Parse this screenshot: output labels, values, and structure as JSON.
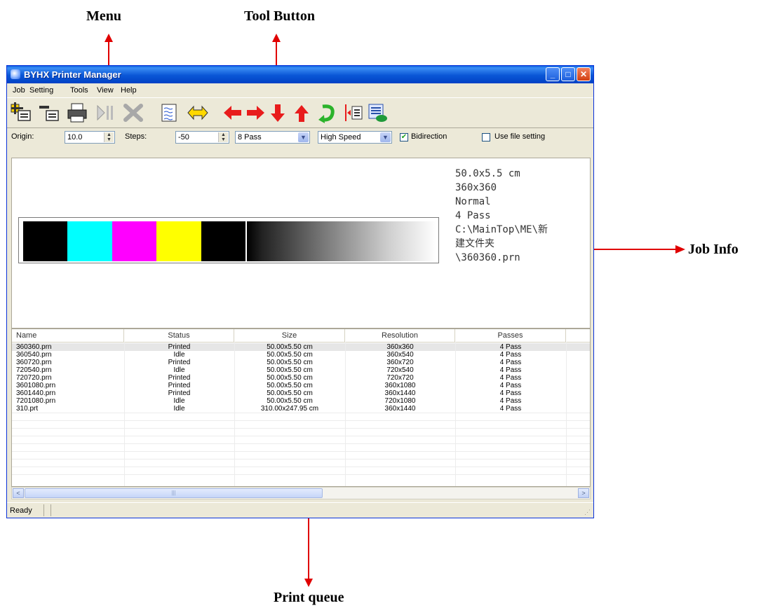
{
  "callouts": {
    "menu": "Menu",
    "tool_button": "Tool Button",
    "job_info": "Job Info",
    "print_queue": "Print queue"
  },
  "window": {
    "title": "BYHX Printer Manager",
    "controls": {
      "minimize": "_",
      "maximize": "□",
      "close": "✕"
    }
  },
  "menu": {
    "items": [
      {
        "label": "Job",
        "mnemonic": "J"
      },
      {
        "label": "Setting",
        "mnemonic": "S"
      },
      {
        "label": "Tools",
        "mnemonic": "T"
      },
      {
        "label": "View",
        "mnemonic": "V"
      },
      {
        "label": "Help",
        "mnemonic": "H"
      }
    ]
  },
  "toolbar": {
    "buttons": [
      "add-job-icon",
      "remove-job-icon",
      "print-icon",
      "pause-icon",
      "abort-icon",
      "wave-icon",
      "horizontal-move-icon",
      "arrow-left-icon",
      "arrow-right-icon",
      "arrow-down-icon",
      "arrow-up-icon",
      "rotate-icon",
      "measure-icon",
      "settings-icon"
    ]
  },
  "options": {
    "origin_label": "Origin:",
    "origin_value": "10.0",
    "steps_label": "Steps:",
    "steps_value": "-50",
    "pass_value": "8 Pass",
    "speed_value": "High Speed",
    "bidirection_label": "Bidirection",
    "bidirection_checked": true,
    "use_file_label": "Use file setting",
    "use_file_checked": false
  },
  "preview": {
    "swatch_colors": [
      "#000000",
      "#00ffff",
      "#ff00ff",
      "#ffff00",
      "#000000"
    ],
    "job_info_lines": [
      "50.0x5.5 cm",
      "360x360",
      "Normal",
      "4 Pass",
      "",
      "",
      "C:\\MainTop\\ME\\新",
      "建文件夹",
      "\\360360.prn"
    ]
  },
  "queue": {
    "columns": [
      "Name",
      "Status",
      "Size",
      "Resolution",
      "Passes"
    ],
    "rows": [
      [
        "360360.prn",
        "Printed",
        "50.00x5.50 cm",
        "360x360",
        "4 Pass"
      ],
      [
        "360540.prn",
        "Idle",
        "50.00x5.50 cm",
        "360x540",
        "4 Pass"
      ],
      [
        "360720.prn",
        "Printed",
        "50.00x5.50 cm",
        "360x720",
        "4 Pass"
      ],
      [
        "720540.prn",
        "Idle",
        "50.00x5.50 cm",
        "720x540",
        "4 Pass"
      ],
      [
        "720720.prn",
        "Printed",
        "50.00x5.50 cm",
        "720x720",
        "4 Pass"
      ],
      [
        "3601080.prn",
        "Printed",
        "50.00x5.50 cm",
        "360x1080",
        "4 Pass"
      ],
      [
        "3601440.prn",
        "Printed",
        "50.00x5.50 cm",
        "360x1440",
        "4 Pass"
      ],
      [
        "7201080.prn",
        "Idle",
        "50.00x5.50 cm",
        "720x1080",
        "4 Pass"
      ],
      [
        "310.prt",
        "Idle",
        "310.00x247.95 cm",
        "360x1440",
        "4 Pass"
      ]
    ],
    "selected_row": 0
  },
  "scrollbar": {
    "left": "<",
    "right": ">",
    "grip": "|||"
  },
  "status": {
    "text": "Ready"
  },
  "colors": {
    "arrow": "#e00000",
    "title_blue": "#0a56d6"
  }
}
